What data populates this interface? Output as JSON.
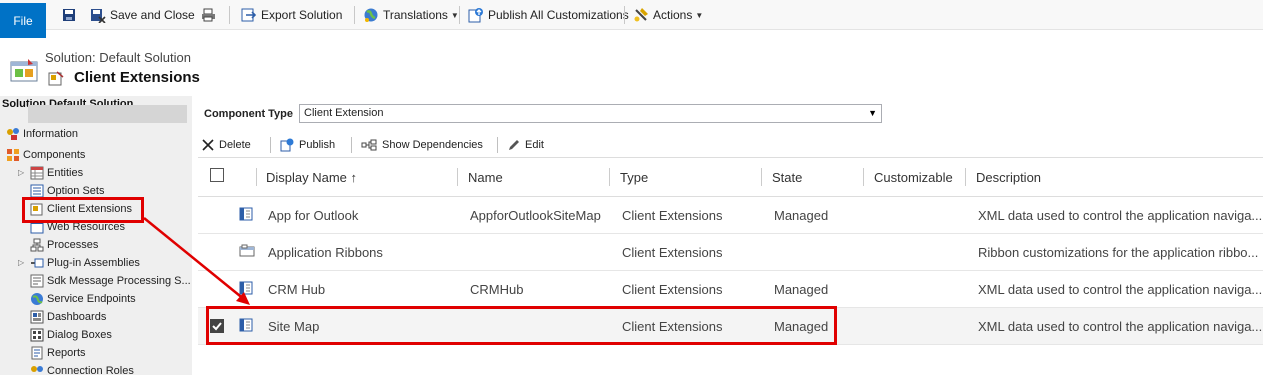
{
  "toolbar": {
    "file": "File",
    "save_and_close": "Save and Close",
    "export_solution": "Export Solution",
    "translations": "Translations",
    "publish_all": "Publish All Customizations",
    "actions": "Actions"
  },
  "header": {
    "solution_label": "Solution: Default Solution",
    "title": "Client Extensions"
  },
  "nav": {
    "title": "Solution Default Solution",
    "items": [
      {
        "label": "Information"
      },
      {
        "label": "Components"
      },
      {
        "label": "Entities"
      },
      {
        "label": "Option Sets"
      },
      {
        "label": "Client Extensions"
      },
      {
        "label": "Web Resources"
      },
      {
        "label": "Processes"
      },
      {
        "label": "Plug-in Assemblies"
      },
      {
        "label": "Sdk Message Processing S..."
      },
      {
        "label": "Service Endpoints"
      },
      {
        "label": "Dashboards"
      },
      {
        "label": "Dialog Boxes"
      },
      {
        "label": "Reports"
      },
      {
        "label": "Connection Roles"
      }
    ]
  },
  "filter": {
    "label": "Component Type",
    "value": "Client Extension"
  },
  "commands": {
    "delete": "Delete",
    "publish": "Publish",
    "show_dependencies": "Show Dependencies",
    "edit": "Edit"
  },
  "grid": {
    "columns": [
      "Display Name ↑",
      "Name",
      "Type",
      "State",
      "Customizable",
      "Description"
    ],
    "rows": [
      {
        "display_name": "App for Outlook",
        "name": "AppforOutlookSiteMap",
        "type": "Client Extensions",
        "state": "Managed",
        "customizable": "",
        "description": "XML data used to control the application naviga...",
        "checked": false
      },
      {
        "display_name": "Application Ribbons",
        "name": "",
        "type": "Client Extensions",
        "state": "",
        "customizable": "",
        "description": "Ribbon customizations for the application ribbo...",
        "checked": false
      },
      {
        "display_name": "CRM Hub",
        "name": "CRMHub",
        "type": "Client Extensions",
        "state": "Managed",
        "customizable": "",
        "description": "XML data used to control the application naviga...",
        "checked": false
      },
      {
        "display_name": "Site Map",
        "name": "",
        "type": "Client Extensions",
        "state": "Managed",
        "customizable": "",
        "description": "XML data used to control the application naviga...",
        "checked": true
      }
    ]
  },
  "colors": {
    "file_button": "#0072c6",
    "annotation": "#e00000",
    "nav_bg": "#efefef"
  }
}
